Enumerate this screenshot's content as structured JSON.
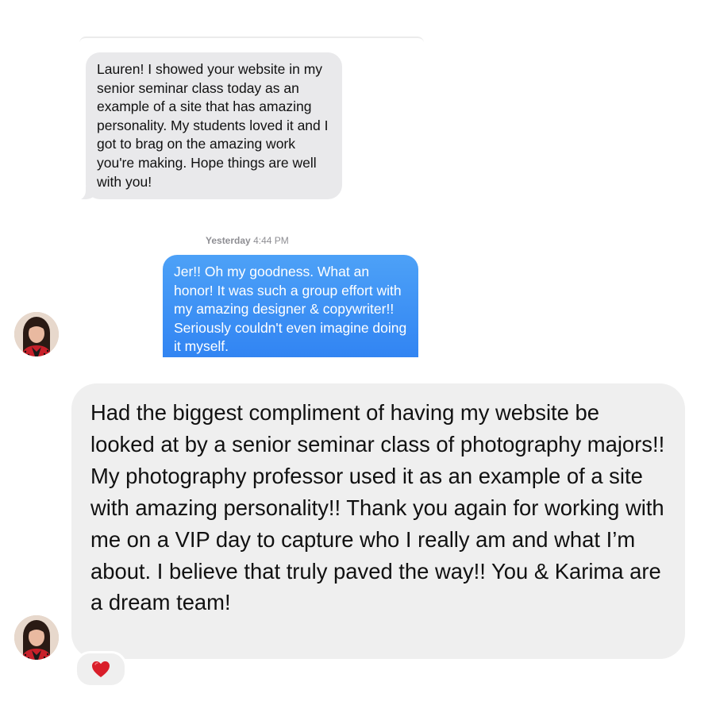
{
  "imessage_screenshot": {
    "incoming_message": "Lauren! I showed your website in my senior seminar class today as an example of a site that has amazing personality. My students loved it and I got to brag on the amazing work you're making. Hope things are well with you!",
    "timestamp_day": "Yesterday",
    "timestamp_time": "4:44 PM",
    "outgoing_message": "Jer!! Oh my goodness. What an honor! It was such a group effort with my amazing designer & copywriter!! Seriously couldn't even imagine doing it myself."
  },
  "dm_message": {
    "text": "Had the biggest compliment of having my website be looked at by a senior seminar class of photography majors!! My photography professor used it as an example of a site with amazing personality!! Thank you again for working with me on a VIP day to capture who I really am and what I’m about. I believe that truly paved the way!! You & Karima are a dream team!",
    "reaction_icon": "red-heart-icon"
  },
  "colors": {
    "imessage_blue": "#3b8ff5",
    "imessage_gray": "#e9e9eb",
    "dm_bubble_gray": "#efefef",
    "heart_red": "#d91e2a"
  }
}
